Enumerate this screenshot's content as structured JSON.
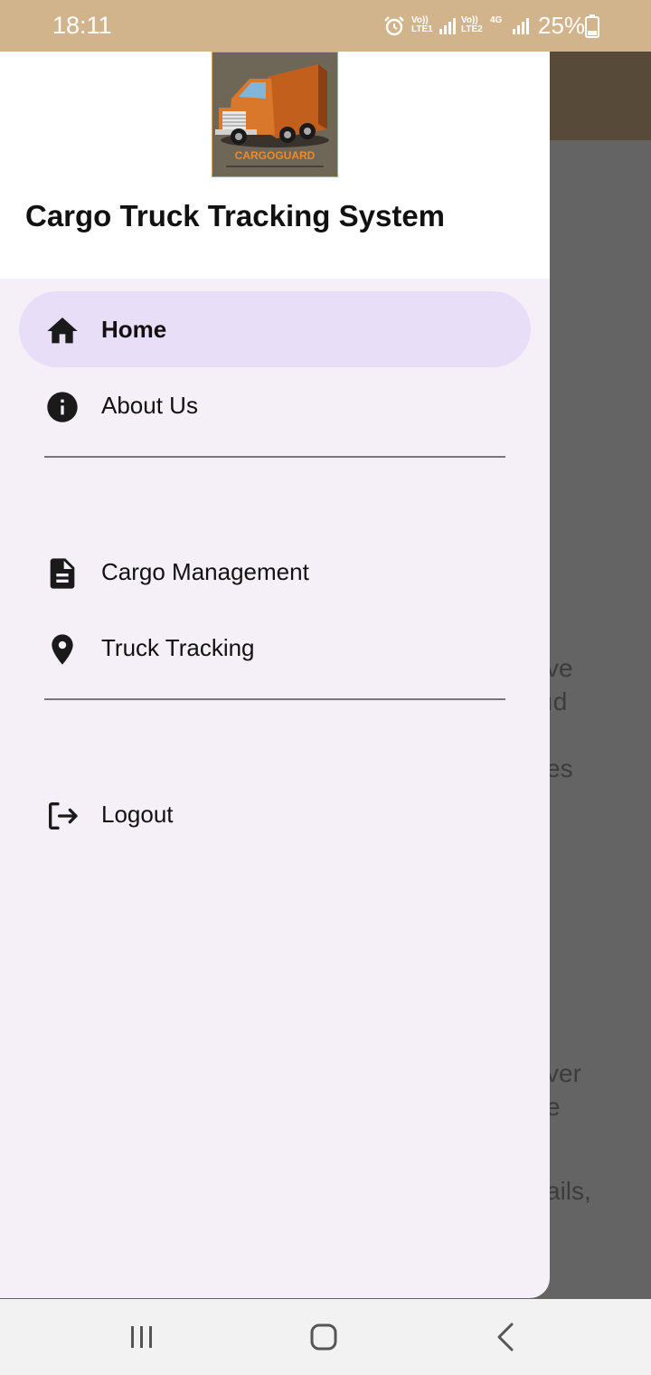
{
  "status_bar": {
    "time": "18:11",
    "sim1_label": "Vo)) LTE1",
    "sim2_label": "Vo)) LTE2",
    "network_label": "4G",
    "battery": "25%"
  },
  "drawer": {
    "logo_text": "CARGOGUARD",
    "title": "Cargo Truck Tracking System",
    "items": [
      {
        "label": "Home",
        "icon": "home-icon",
        "active": true
      },
      {
        "label": "About Us",
        "icon": "info-icon",
        "active": false
      },
      {
        "label": "Cargo Management",
        "icon": "document-icon",
        "active": false
      },
      {
        "label": "Truck Tracking",
        "icon": "location-pin-icon",
        "active": false
      },
      {
        "label": "Logout",
        "icon": "logout-icon",
        "active": false
      }
    ]
  },
  "background_text": [
    "ve",
    "ıd",
    "es",
    "ver",
    "e",
    "ails,"
  ],
  "colors": {
    "status_bar": "#d2b48c",
    "drawer_bg": "#f5f0f8",
    "active_item": "#e8def8",
    "scrim": "#646464"
  }
}
